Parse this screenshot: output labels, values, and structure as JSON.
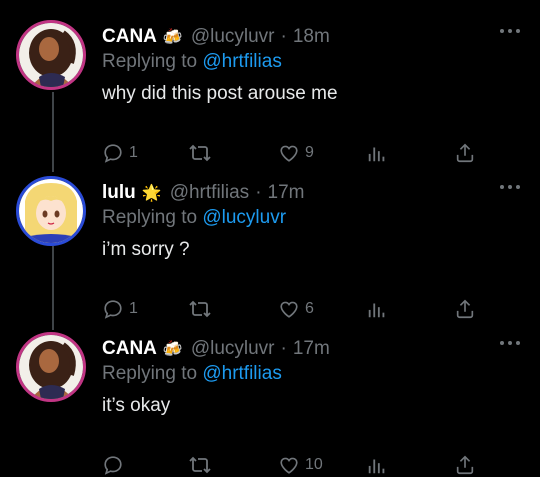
{
  "tweets": [
    {
      "display_name": "CANA",
      "badge": "🍻",
      "handle": "@lucyluvr",
      "separator": "·",
      "time": "18m",
      "replying_prefix": "Replying to",
      "replying_to": "@hrtfilias",
      "text": "why did this post arouse me",
      "reply_count": "1",
      "retweet_count": "",
      "like_count": "9",
      "avatar_ring_color": "#c13584"
    },
    {
      "display_name": "lulu",
      "badge": "🌟",
      "handle": "@hrtfilias",
      "separator": "·",
      "time": "17m",
      "replying_prefix": "Replying to",
      "replying_to": "@lucyluvr",
      "text": "i’m sorry ?",
      "reply_count": "1",
      "retweet_count": "",
      "like_count": "6",
      "avatar_ring_color": "#2a4bd7"
    },
    {
      "display_name": "CANA",
      "badge": "🍻",
      "handle": "@lucyluvr",
      "separator": "·",
      "time": "17m",
      "replying_prefix": "Replying to",
      "replying_to": "@hrtfilias",
      "text": "it’s okay",
      "reply_count": "",
      "retweet_count": "",
      "like_count": "10",
      "avatar_ring_color": "#c13584"
    }
  ],
  "icons": {
    "more": "more-horizontal-icon",
    "reply": "reply-icon",
    "retweet": "retweet-icon",
    "like": "heart-icon",
    "views": "views-icon",
    "share": "share-icon"
  },
  "colors": {
    "background": "#000000",
    "text": "#e7e9ea",
    "muted": "#71767b",
    "link": "#1d9bf0",
    "thread_line": "#3f4448"
  }
}
